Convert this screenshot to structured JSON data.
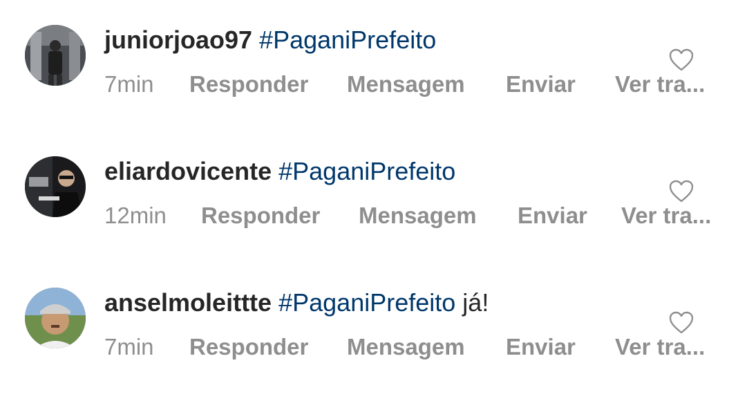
{
  "comments": [
    {
      "username": "juniorjoao97",
      "hashtag": "#PaganiPrefeito",
      "suffix": "",
      "time": "7min",
      "actions": [
        "Responder",
        "Mensagem",
        "Enviar",
        "Ver tra..."
      ],
      "avatar_icon": "avatar-photo-icon"
    },
    {
      "username": "eliardovicente",
      "hashtag": "#PaganiPrefeito",
      "suffix": "",
      "time": "12min",
      "actions": [
        "Responder",
        "Mensagem",
        "Enviar",
        "Ver tra..."
      ],
      "avatar_icon": "avatar-photo-icon"
    },
    {
      "username": "anselmoleittte",
      "hashtag": "#PaganiPrefeito",
      "suffix": "já!",
      "time": "7min",
      "actions": [
        "Responder",
        "Mensagem",
        "Enviar",
        "Ver tra..."
      ],
      "avatar_icon": "avatar-photo-icon"
    }
  ],
  "like_icon": "heart-outline-icon",
  "colors": {
    "username": "#262626",
    "hashtag": "#00376b",
    "meta": "#8e8e8e",
    "heart_stroke": "#8e8e8e"
  }
}
